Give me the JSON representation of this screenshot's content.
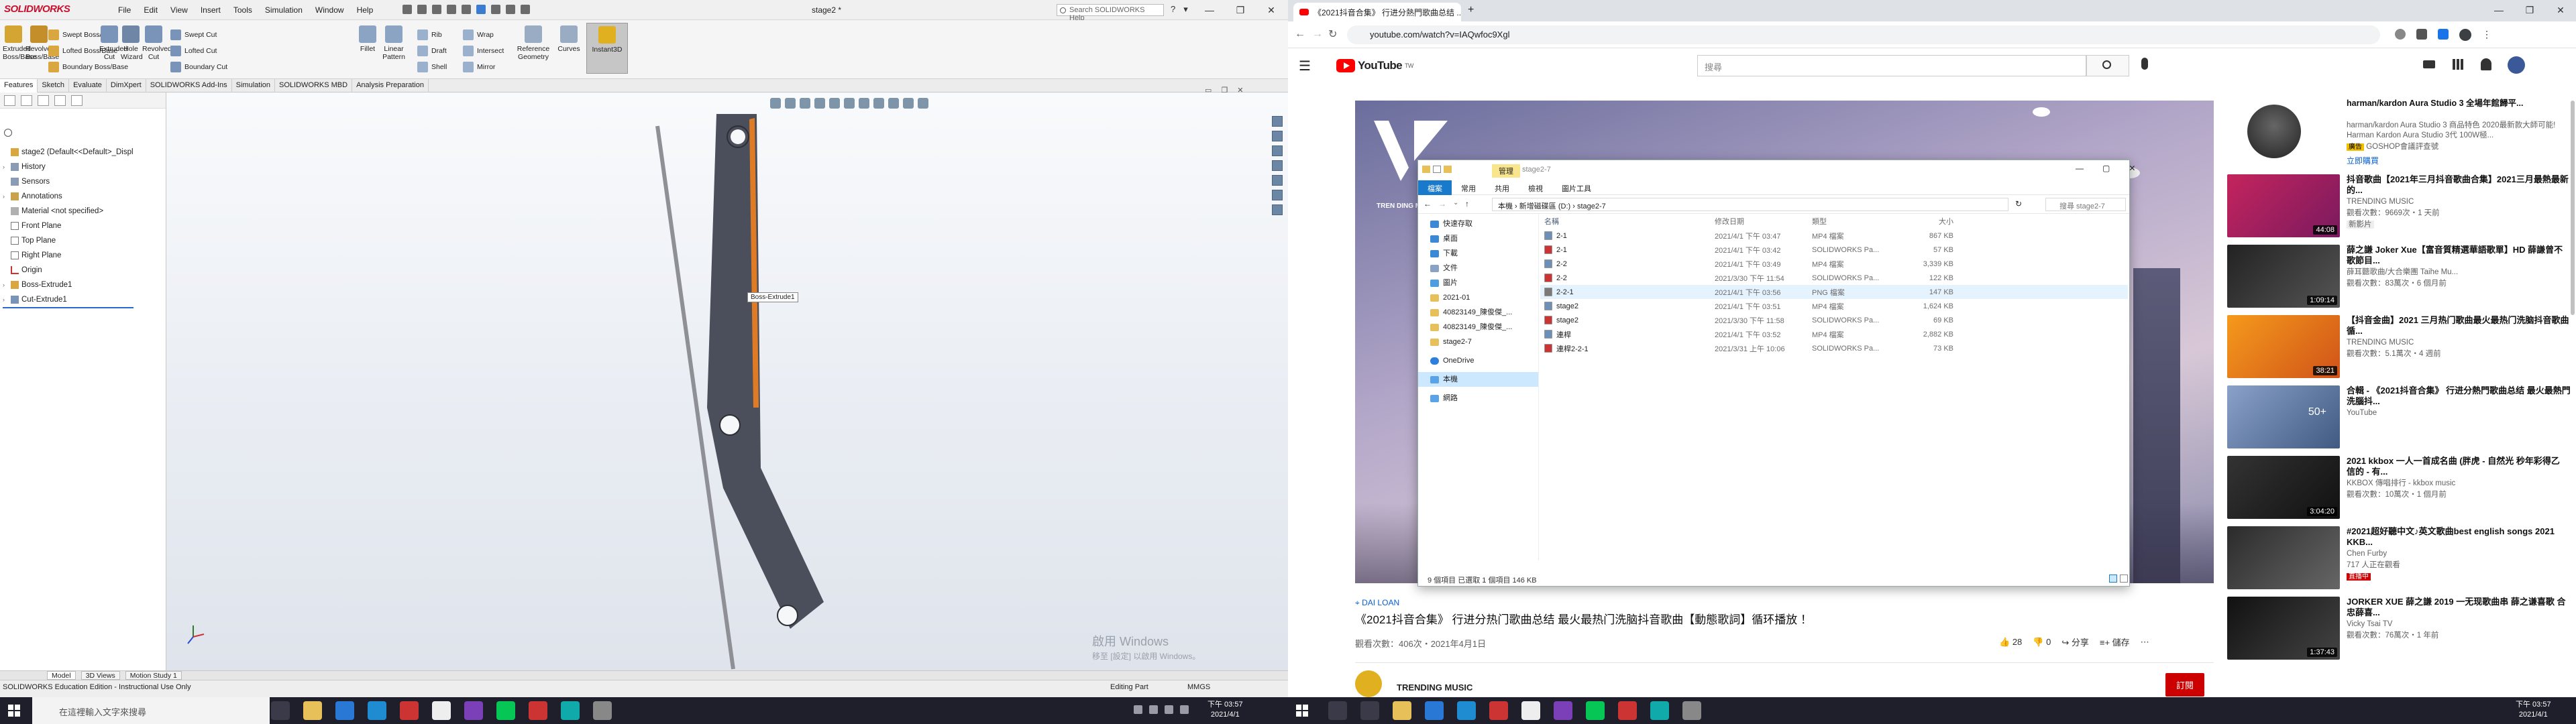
{
  "solidworks": {
    "logo": "SOLIDWORKS",
    "menu": [
      "File",
      "Edit",
      "View",
      "Insert",
      "Tools",
      "Simulation",
      "Window",
      "Help"
    ],
    "doc_title": "stage2 *",
    "search_placeholder": "Search SOLIDWORKS Help",
    "ribbon": {
      "extruded_boss": "Extruded Boss/Base",
      "revolved_boss": "Revolved Boss/Base",
      "swept_boss": "Swept Boss/Base",
      "lofted_boss": "Lofted Boss/Base",
      "boundary_boss": "Boundary Boss/Base",
      "extruded_cut": "Extruded Cut",
      "hole_wizard": "Hole Wizard",
      "revolved_cut": "Revolved Cut",
      "swept_cut": "Swept Cut",
      "lofted_cut": "Lofted Cut",
      "boundary_cut": "Boundary Cut",
      "fillet": "Fillet",
      "linear_pattern": "Linear Pattern",
      "rib": "Rib",
      "draft": "Draft",
      "shell": "Shell",
      "wrap": "Wrap",
      "intersect": "Intersect",
      "mirror": "Mirror",
      "reference_geometry": "Reference Geometry",
      "curves": "Curves",
      "instant3d": "Instant3D"
    },
    "tabs": [
      "Features",
      "Sketch",
      "Evaluate",
      "DimXpert",
      "SOLIDWORKS Add-Ins",
      "Simulation",
      "SOLIDWORKS MBD",
      "Analysis Preparation"
    ],
    "tree": [
      {
        "label": "stage2  (Default<<Default>_Displ",
        "arrow": ""
      },
      {
        "label": "History",
        "arrow": "›"
      },
      {
        "label": "Sensors",
        "arrow": ""
      },
      {
        "label": "Annotations",
        "arrow": "›"
      },
      {
        "label": "Material <not specified>",
        "arrow": ""
      },
      {
        "label": "Front Plane",
        "arrow": ""
      },
      {
        "label": "Top Plane",
        "arrow": ""
      },
      {
        "label": "Right Plane",
        "arrow": ""
      },
      {
        "label": "Origin",
        "arrow": ""
      },
      {
        "label": "Boss-Extrude1",
        "arrow": "›"
      },
      {
        "label": "Cut-Extrude1",
        "arrow": "›"
      }
    ],
    "tooltip": "Boss-Extrude1",
    "watermark_line1": "啟用 Windows",
    "watermark_line2": "移至 [設定] 以啟用 Windows。",
    "bottom_tabs": [
      "Model",
      "3D Views",
      "Motion Study 1"
    ],
    "status_left": "SOLIDWORKS Education Edition - Instructional Use Only",
    "status_mode": "Editing Part",
    "status_units": "MMGS"
  },
  "chrome": {
    "tab_title": "《2021抖音合集》 行进分熱門歌曲总结 ...",
    "url": "youtube.com/watch?v=IAQwfoc9Xgl",
    "search_placeholder": "搜尋",
    "logo_country": "TW",
    "video_brand": "TREN DING MUSIC",
    "video_location": "DAI LOAN",
    "video_title": "《2021抖音合集》 行进分热门歌曲总结 最火最热门洗脑抖音歌曲【動態歌詞】循环播放 ！",
    "video_stats": "觀看次數：406次・2021年4月1日",
    "likes": "28",
    "dislikes": "0",
    "share": "分享",
    "save": "儲存",
    "channel": "TRENDING MUSIC",
    "subscribe": "訂閱",
    "ad": {
      "title": "harman/kardon Aura Studio 3 全場年館歸平...",
      "desc": "harman/kardon Aura Studio 3 商品特色 2020最新款大師可能! Harman Kardon Aura Studio 3代 100W極...",
      "badge": "廣告",
      "source": "GOSHOP會議評查號",
      "cta": "立即購買"
    },
    "recs": [
      {
        "title": "抖音歌曲【2021年三月抖音歌曲合集】2021三月最熱最新的...",
        "channel": "TRENDING MUSIC",
        "stats": "觀看次數：9669次・1 天前",
        "badge": "新影片",
        "dur": "44:08"
      },
      {
        "title": "薛之謙 Joker Xue【富音質精選華語歌單】HD 薛謙曾不歌節目...",
        "channel": "薛耳聽歌曲/大合樂團 Taihe Mu...",
        "stats": "觀看次數：83萬次・6 個月前",
        "badge": "",
        "dur": "1:09:14"
      },
      {
        "title": "【抖音金曲】2021 三月热门歌曲最火最热门洗脑抖音歌曲 循...",
        "channel": "TRENDING MUSIC",
        "stats": "觀看次數：5.1萬次・4 週前",
        "badge": "",
        "dur": "38:21"
      },
      {
        "title": "合輯 - 《2021抖音合集》 行进分熱門歌曲总结 最火最熱門洗腦抖...",
        "channel": "YouTube",
        "stats": "",
        "badge": "",
        "dur": "50+"
      },
      {
        "title": "2021 kkbox 一人一首成名曲 (胖虎 - 自然光 秒年彩得乙 信的 - 有...",
        "channel": "KKBOX 傳唱排行 - kkbox music",
        "stats": "觀看次數：10萬次・1 個月前",
        "badge": "",
        "dur": "3:04:20"
      },
      {
        "title": "#2021超好聽中文♪英文歌曲best english songs 2021 KKB...",
        "channel": "Chen Furby",
        "stats": "717 人正在觀看",
        "badge": "直播中",
        "dur": ""
      },
      {
        "title": "JORKER XUE 薛之謙 2019 一无现歌曲串 薛之谦喜歌 合忠薛喜...",
        "channel": "Vicky Tsai TV",
        "stats": "觀看次數：76萬次・1 年前",
        "badge": "",
        "dur": "1:37:43"
      }
    ]
  },
  "explorer": {
    "title_path": "stage2-7",
    "manage_label": "管理",
    "ribbon_tabs": [
      "檔案",
      "常用",
      "共用",
      "檢視",
      "圖片工具"
    ],
    "breadcrumb": [
      "本機",
      "新增磁碟區 (D:)",
      "stage2-7"
    ],
    "search_placeholder": "搜尋 stage2-7",
    "sidebar": [
      {
        "label": "快速存取",
        "color": "#3a88d6"
      },
      {
        "label": "桌面",
        "color": "#3a88d6"
      },
      {
        "label": "下載",
        "color": "#3a88d6"
      },
      {
        "label": "文件",
        "color": "#8aa3c4"
      },
      {
        "label": "圖片",
        "color": "#4e9de0"
      },
      {
        "label": "2021-01",
        "color": "#e8c05a"
      },
      {
        "label": "40823149_陳俊傑_...",
        "color": "#e8c05a"
      },
      {
        "label": "40823149_陳俊傑_...",
        "color": "#e8c05a"
      },
      {
        "label": "stage2-7",
        "color": "#e8c05a"
      },
      {
        "label": "OneDrive",
        "color": "#2d7fdc"
      },
      {
        "label": "本機",
        "color": "#5aa3e8"
      },
      {
        "label": "網路",
        "color": "#5aa3e8"
      }
    ],
    "columns": [
      "名稱",
      "修改日期",
      "類型",
      "大小"
    ],
    "files": [
      {
        "name": "2-1",
        "date": "2021/4/1 下午 03:47",
        "type": "MP4 檔案",
        "size": "867 KB",
        "color": "#6e8fb8"
      },
      {
        "name": "2-1",
        "date": "2021/4/1 下午 03:42",
        "type": "SOLIDWORKS Pa...",
        "size": "57 KB",
        "color": "#c33"
      },
      {
        "name": "2-2",
        "date": "2021/4/1 下午 03:49",
        "type": "MP4 檔案",
        "size": "3,339 KB",
        "color": "#6e8fb8"
      },
      {
        "name": "2-2",
        "date": "2021/3/30 下午 11:54",
        "type": "SOLIDWORKS Pa...",
        "size": "122 KB",
        "color": "#c33"
      },
      {
        "name": "2-2-1",
        "date": "2021/4/1 下午 03:56",
        "type": "PNG 檔案",
        "size": "147 KB",
        "color": "#7a7a7a"
      },
      {
        "name": "stage2",
        "date": "2021/4/1 下午 03:51",
        "type": "MP4 檔案",
        "size": "1,624 KB",
        "color": "#6e8fb8"
      },
      {
        "name": "stage2",
        "date": "2021/3/30 下午 11:58",
        "type": "SOLIDWORKS Pa...",
        "size": "69 KB",
        "color": "#c33"
      },
      {
        "name": "連桿",
        "date": "2021/4/1 下午 03:52",
        "type": "MP4 檔案",
        "size": "2,882 KB",
        "color": "#6e8fb8"
      },
      {
        "name": "連桿2-2-1",
        "date": "2021/3/31 上午 10:06",
        "type": "SOLIDWORKS Pa...",
        "size": "73 KB",
        "color": "#c33"
      }
    ],
    "status": "9 個項目     已選取 1 個項目  146 KB"
  },
  "taskbar": {
    "search_placeholder": "在這裡輸入文字來搜尋",
    "time": "下午 03:57",
    "date": "2021/4/1"
  }
}
